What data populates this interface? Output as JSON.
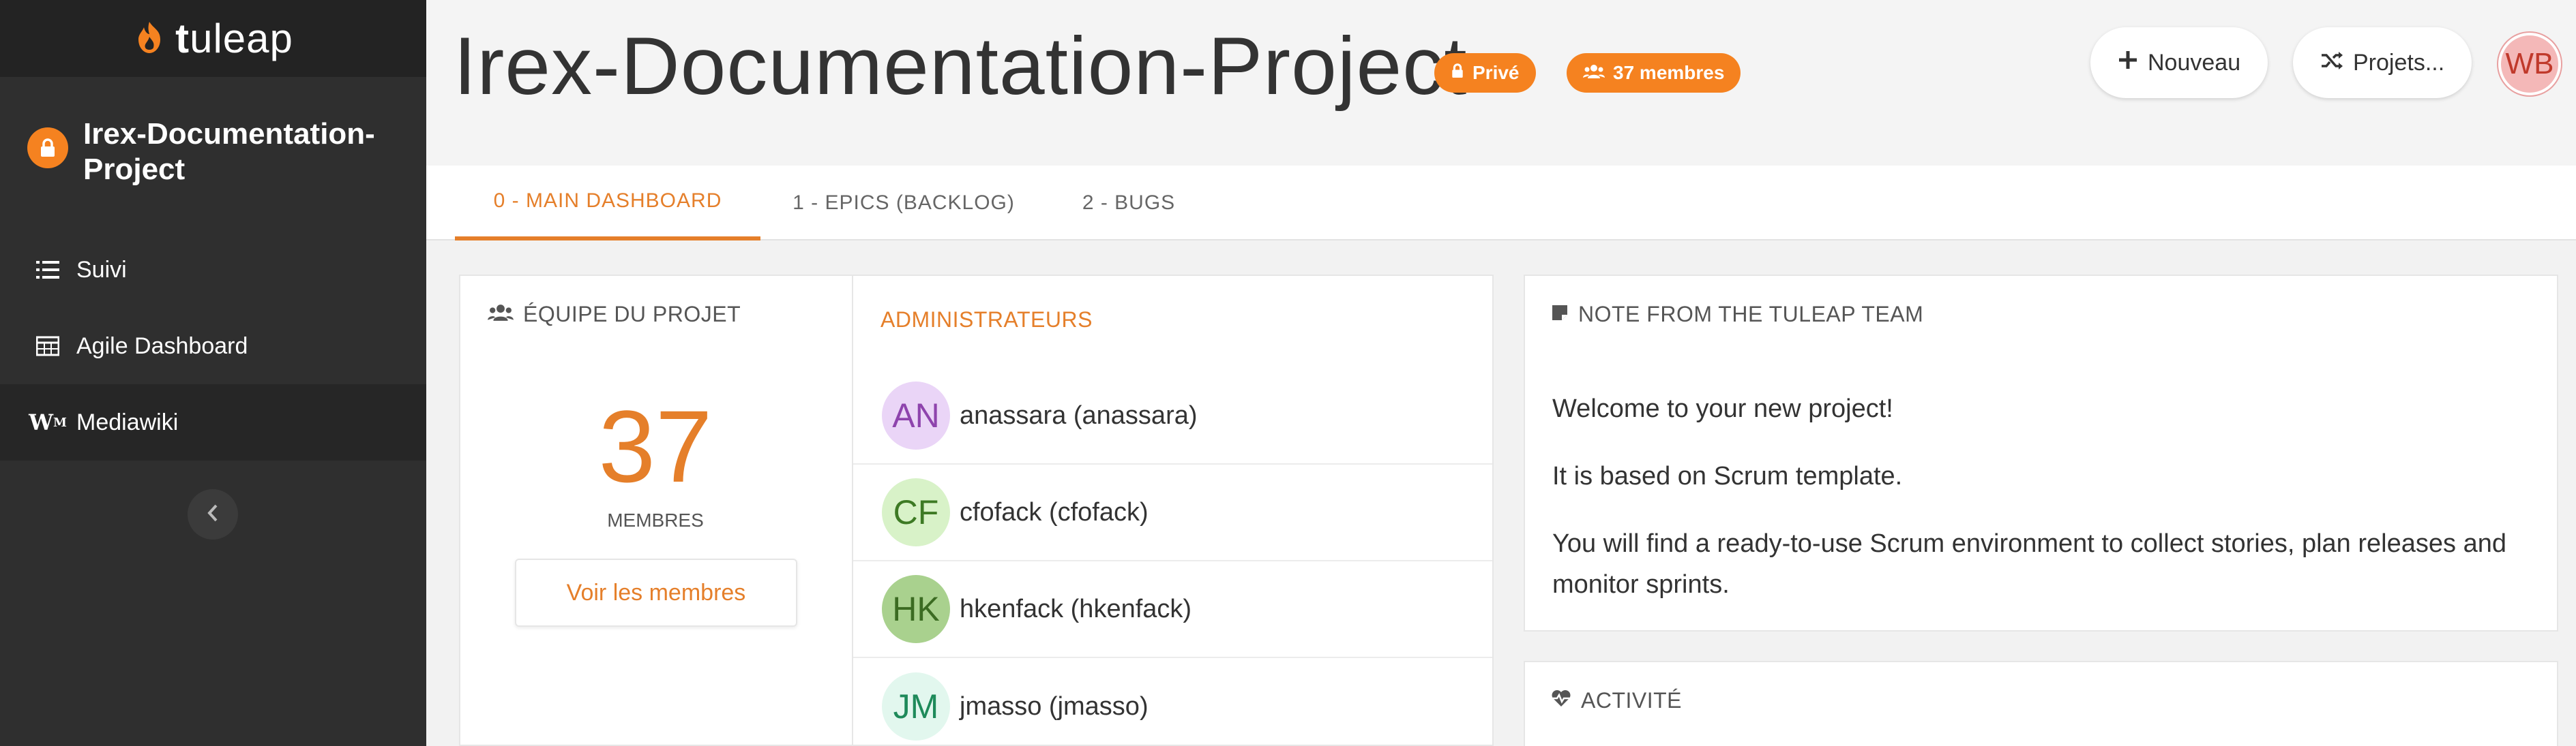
{
  "sidebar": {
    "logo_text_bold": "t",
    "logo_text_rest": "uleap",
    "project_name": "Irex-Documentation-Project",
    "items": [
      {
        "label": "Suivi",
        "icon": "list-icon"
      },
      {
        "label": "Agile Dashboard",
        "icon": "table-icon"
      },
      {
        "label": "Mediawiki",
        "icon": "mediawiki-icon"
      }
    ],
    "collapse_icon": "chevron-left-icon"
  },
  "header": {
    "title": "Irex-Documentation-Project",
    "privacy_badge": "Privé",
    "members_badge": "37 membres",
    "new_button": "Nouveau",
    "projects_button": "Projets...",
    "user_initials": "WB"
  },
  "tabs": [
    {
      "label": "0 - MAIN DASHBOARD",
      "active": true
    },
    {
      "label": "1 - EPICS (BACKLOG)",
      "active": false
    },
    {
      "label": "2 - BUGS",
      "active": false
    }
  ],
  "team": {
    "title": "ÉQUIPE DU PROJET",
    "count": "37",
    "count_label": "MEMBRES",
    "see_members": "Voir les membres",
    "admins_label": "ADMINISTRATEURS",
    "members": [
      {
        "initials": "AN",
        "name": "anassara (anassara)",
        "bg": "#ead5f7",
        "fg": "#8e44ad"
      },
      {
        "initials": "CF",
        "name": "cfofack (cfofack)",
        "bg": "#d8f2c8",
        "fg": "#3d7a24"
      },
      {
        "initials": "HK",
        "name": "hkenfack (hkenfack)",
        "bg": "#a9d18e",
        "fg": "#3b6b22"
      },
      {
        "initials": "JM",
        "name": "jmasso (jmasso)",
        "bg": "#e2f7ee",
        "fg": "#1e8a5a"
      }
    ]
  },
  "note": {
    "title": "NOTE FROM THE TULEAP TEAM",
    "paragraphs": [
      "Welcome to your new project!",
      "It is based on Scrum template.",
      "You will find a ready-to-use Scrum environment to collect stories, plan releases and monitor sprints."
    ]
  },
  "activity": {
    "title": "ACTIVITÉ"
  },
  "colors": {
    "accent": "#e57f2a",
    "badge": "#f58220",
    "sidebar": "#2f2f2f"
  }
}
